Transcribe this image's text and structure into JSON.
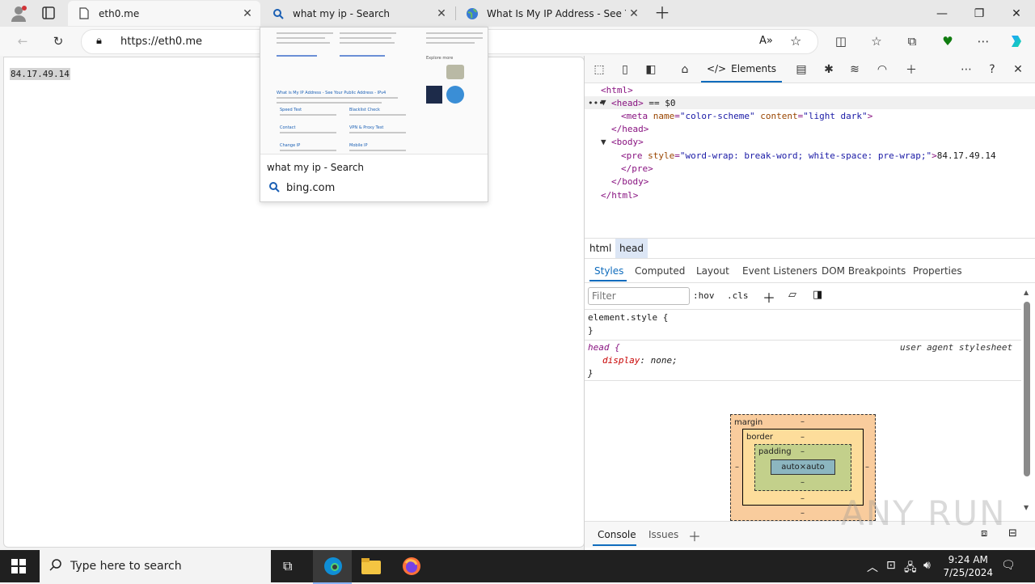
{
  "tabs": [
    {
      "title": "eth0.me",
      "active": true
    },
    {
      "title": "what my ip - Search",
      "active": false
    },
    {
      "title": "What Is My IP Address - See Your",
      "active": false
    }
  ],
  "address_bar": {
    "url": "https://eth0.me"
  },
  "page": {
    "ip_text": "84.17.49.14"
  },
  "tab_preview": {
    "title": "what my ip - Search",
    "domain": "bing.com",
    "thumb_links": [
      "What is My IP Address - See Your Public Address - IPv4",
      "Speed Test",
      "Blacklist Check",
      "Contact",
      "VPN & Proxy Test",
      "Change IP",
      "Mobile IP",
      "Explore more"
    ]
  },
  "devtools": {
    "elements_tab": "Elements",
    "dom": {
      "html_open": "<html>",
      "head_open": "<head>",
      "selected_marker": "== $0",
      "meta_tag": "meta",
      "meta_name_attr": "name",
      "meta_name_val": "\"color-scheme\"",
      "meta_content_attr": "content",
      "meta_content_val": "\"light dark\"",
      "head_close": "</head>",
      "body_open": "<body>",
      "pre_tag": "pre",
      "pre_style_attr": "style",
      "pre_style_val": "\"word-wrap: break-word; white-space: pre-wrap;\"",
      "pre_text": "84.17.49.14",
      "pre_close": "</pre>",
      "body_close": "</body>",
      "html_close": "</html>"
    },
    "breadcrumbs": [
      "html",
      "head"
    ],
    "subtabs": [
      "Styles",
      "Computed",
      "Layout",
      "Event Listeners",
      "DOM Breakpoints",
      "Properties"
    ],
    "filter_placeholder": "Filter",
    "hov": ":hov",
    "cls": ".cls",
    "styles": {
      "element_style_open": "element.style {",
      "element_style_close": "}",
      "head_selector": "head {",
      "ua_label": "user agent stylesheet",
      "prop": "display",
      "value": "none;",
      "close": "}"
    },
    "box_model": {
      "margin": "margin",
      "border": "border",
      "padding": "padding",
      "content": "auto×auto",
      "dash": "–"
    },
    "drawer": [
      "Console",
      "Issues"
    ]
  },
  "taskbar": {
    "search_text": "Type here to search",
    "time": "9:24 AM",
    "date": "7/25/2024"
  },
  "watermark": "ANY RUN"
}
